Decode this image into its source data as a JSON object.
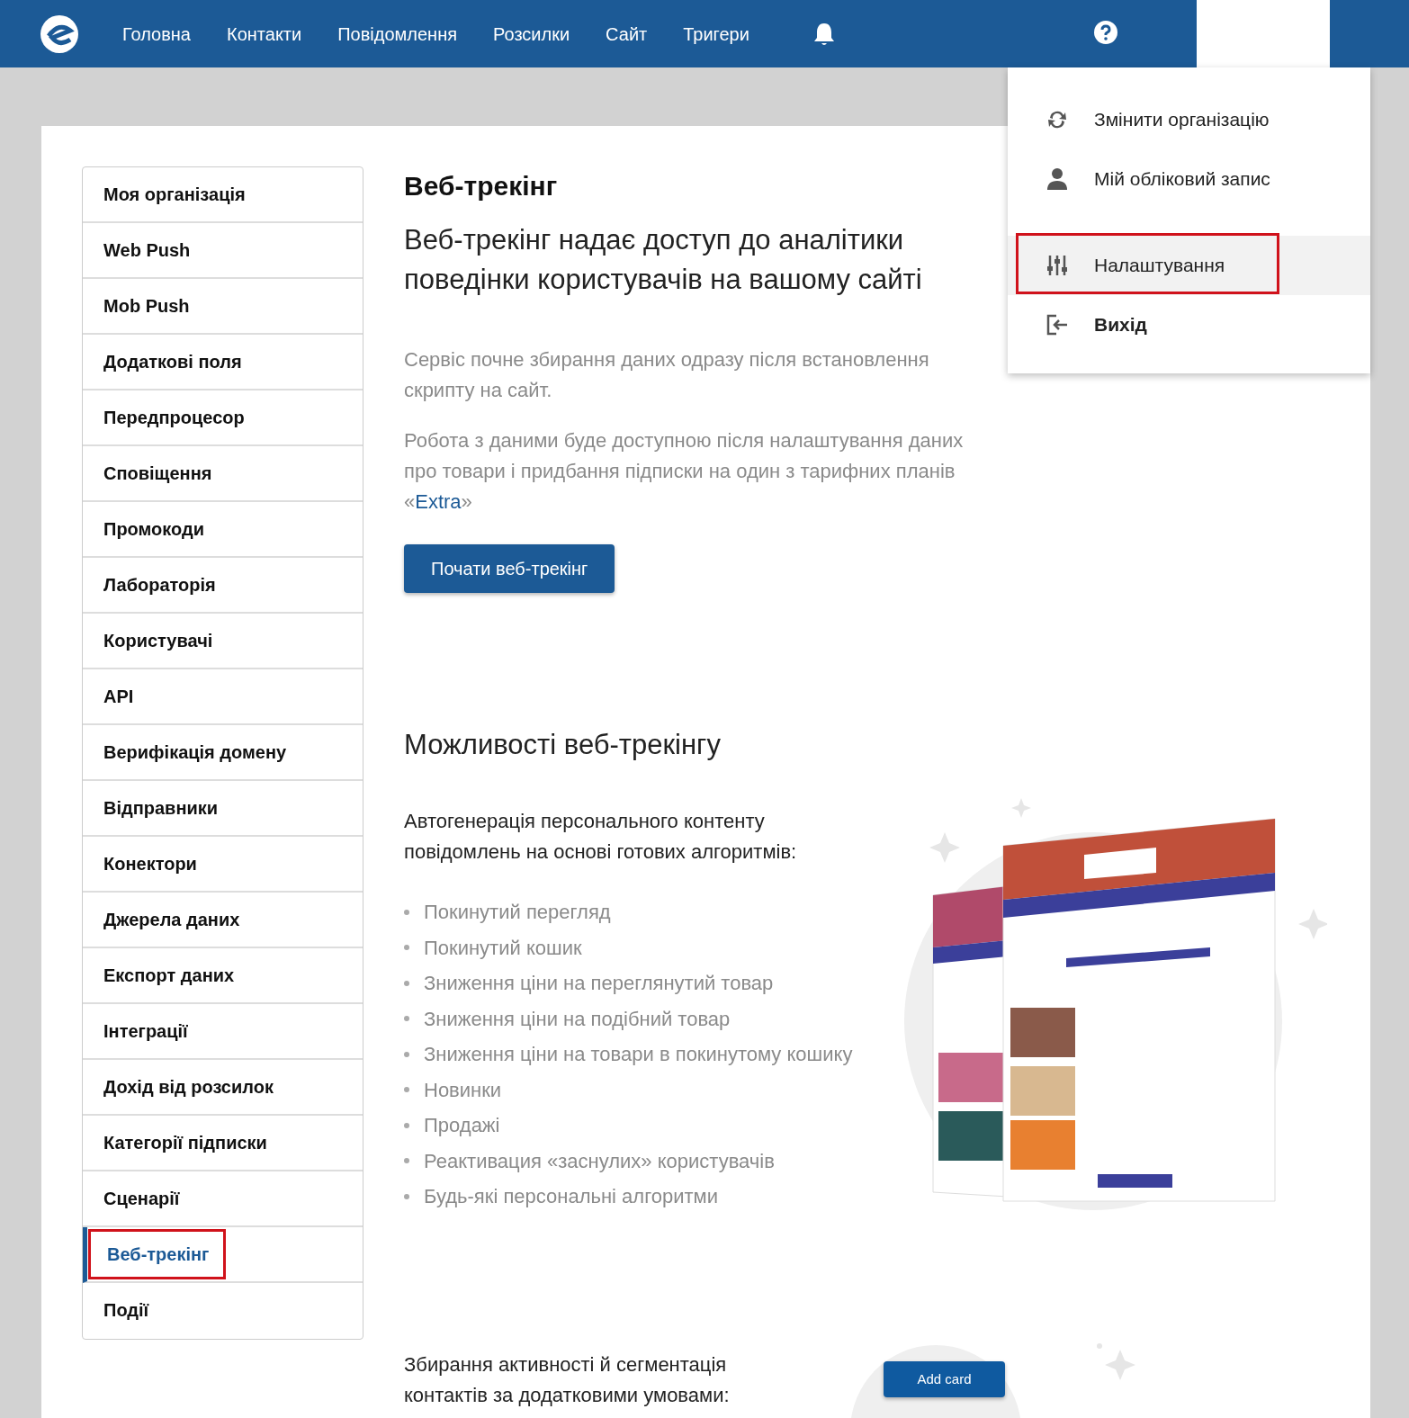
{
  "navbar": {
    "items": [
      {
        "label": "Головна"
      },
      {
        "label": "Контакти"
      },
      {
        "label": "Повідомлення"
      },
      {
        "label": "Розсилки"
      },
      {
        "label": "Сайт"
      },
      {
        "label": "Тригери"
      }
    ]
  },
  "user_menu": {
    "items": [
      {
        "kind": "switch",
        "label": "Змінити організацію",
        "bold": false,
        "hovered": false,
        "highlighted": false
      },
      {
        "kind": "account",
        "label": "Мій обліковий запис",
        "bold": false,
        "hovered": false,
        "highlighted": false
      },
      {
        "kind": "settings",
        "label": "Налаштування",
        "bold": false,
        "hovered": true,
        "highlighted": true
      },
      {
        "kind": "logout",
        "label": "Вихід",
        "bold": true,
        "hovered": false,
        "highlighted": false
      }
    ]
  },
  "sidebar": {
    "items": [
      {
        "label": "Моя організація",
        "selected": false,
        "highlighted": false
      },
      {
        "label": "Web Push",
        "selected": false,
        "highlighted": false
      },
      {
        "label": "Mob Push",
        "selected": false,
        "highlighted": false
      },
      {
        "label": "Додаткові поля",
        "selected": false,
        "highlighted": false
      },
      {
        "label": "Передпроцесор",
        "selected": false,
        "highlighted": false
      },
      {
        "label": "Сповіщення",
        "selected": false,
        "highlighted": false
      },
      {
        "label": "Промокоди",
        "selected": false,
        "highlighted": false
      },
      {
        "label": "Лабораторія",
        "selected": false,
        "highlighted": false
      },
      {
        "label": "Користувачі",
        "selected": false,
        "highlighted": false
      },
      {
        "label": "API",
        "selected": false,
        "highlighted": false
      },
      {
        "label": "Верифікація домену",
        "selected": false,
        "highlighted": false
      },
      {
        "label": "Відправники",
        "selected": false,
        "highlighted": false
      },
      {
        "label": "Конектори",
        "selected": false,
        "highlighted": false
      },
      {
        "label": "Джерела даних",
        "selected": false,
        "highlighted": false
      },
      {
        "label": "Експорт даних",
        "selected": false,
        "highlighted": false
      },
      {
        "label": "Інтеграції",
        "selected": false,
        "highlighted": false
      },
      {
        "label": "Дохід від розсилок",
        "selected": false,
        "highlighted": false
      },
      {
        "label": "Категорії підписки",
        "selected": false,
        "highlighted": false
      },
      {
        "label": "Сценарії",
        "selected": false,
        "highlighted": false
      },
      {
        "label": "Веб-трекінг",
        "selected": true,
        "highlighted": true
      },
      {
        "label": "Події",
        "selected": false,
        "highlighted": false
      }
    ]
  },
  "content": {
    "title": "Веб-трекінг",
    "subtitle": "Веб-трекінг надає доступ до аналітики поведінки користувачів на вашому сайті",
    "paragraph_1": "Сервіс почне збирання даних одразу після встановлення скрипту на сайт.",
    "paragraph_2": {
      "text_before": "Робота з даними буде доступною після налаштування даних про товари і придбання підписки на один з тарифних планів «",
      "link": "Extra",
      "text_after": "»"
    },
    "start_button": "Почати веб-трекінг",
    "features_heading": "Можливості веб-трекінгу",
    "features_intro": "Автогенерація персонального контенту повідомлень на основі готових алгоритмів:",
    "features": [
      "Покинутий перегляд",
      "Покинутий кошик",
      "Зниження ціни на переглянутий товар",
      "Зниження ціни на подібний товар",
      "Зниження ціни на товари в покинутому кошику",
      "Новинки",
      "Продажі",
      "Реактивация «заснулих» користувачів",
      "Будь-які персональні алгоритми"
    ],
    "segmentation_intro": "Збирання активності й сегментація контактів за додатковими умовами:",
    "illustration_button": "Add card"
  }
}
